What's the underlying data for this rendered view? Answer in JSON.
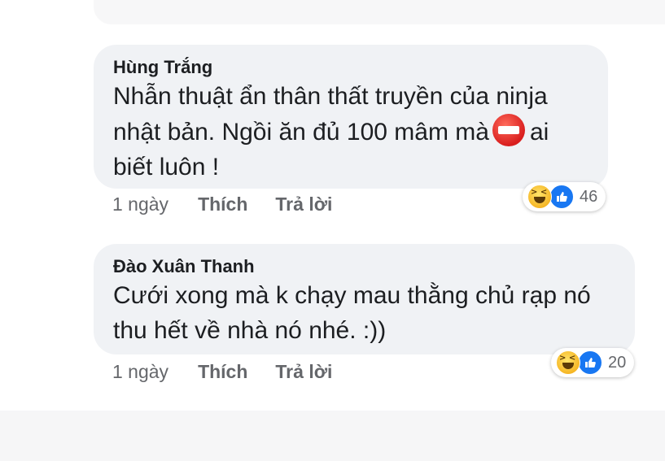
{
  "comments": [
    {
      "author": "Hùng Trắng",
      "text_part1": "Nhẫn thuật ẩn thân thất truyền của ninja nhật bản. Ngồi ăn đủ 100 mâm mà",
      "text_part2": "ai biết luôn !",
      "emoji": "no-entry-icon",
      "time": "1 ngày",
      "like_label": "Thích",
      "reply_label": "Trả lời",
      "reaction_count": "46"
    },
    {
      "author": "Đào Xuân Thanh",
      "text": "Cưới xong mà k chạy mau thằng chủ rạp nó thu hết về nhà nó nhé. :))",
      "time": "1 ngày",
      "like_label": "Thích",
      "reply_label": "Trả lời",
      "reaction_count": "20"
    }
  ],
  "reaction_icons": [
    "haha-icon",
    "like-icon"
  ],
  "colors": {
    "bubble": "#f0f2f5",
    "text": "#1c1e21",
    "meta": "#65676b",
    "like_blue": "#1877f2"
  }
}
